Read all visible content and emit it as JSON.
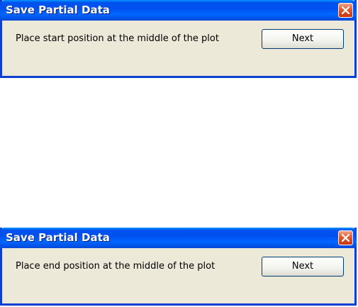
{
  "dialogs": [
    {
      "title": "Save Partial Data",
      "message": "Place start position at the middle of the plot",
      "button_label": "Next",
      "close_icon": "close-icon"
    },
    {
      "title": "Save Partial Data",
      "message": "Place end position at the middle of the plot",
      "button_label": "Next",
      "close_icon": "close-icon"
    }
  ],
  "colors": {
    "titlebar": "#0054e3",
    "frame": "#0a3fd3",
    "client": "#ece9d8",
    "close_button": "#e25b2b"
  }
}
